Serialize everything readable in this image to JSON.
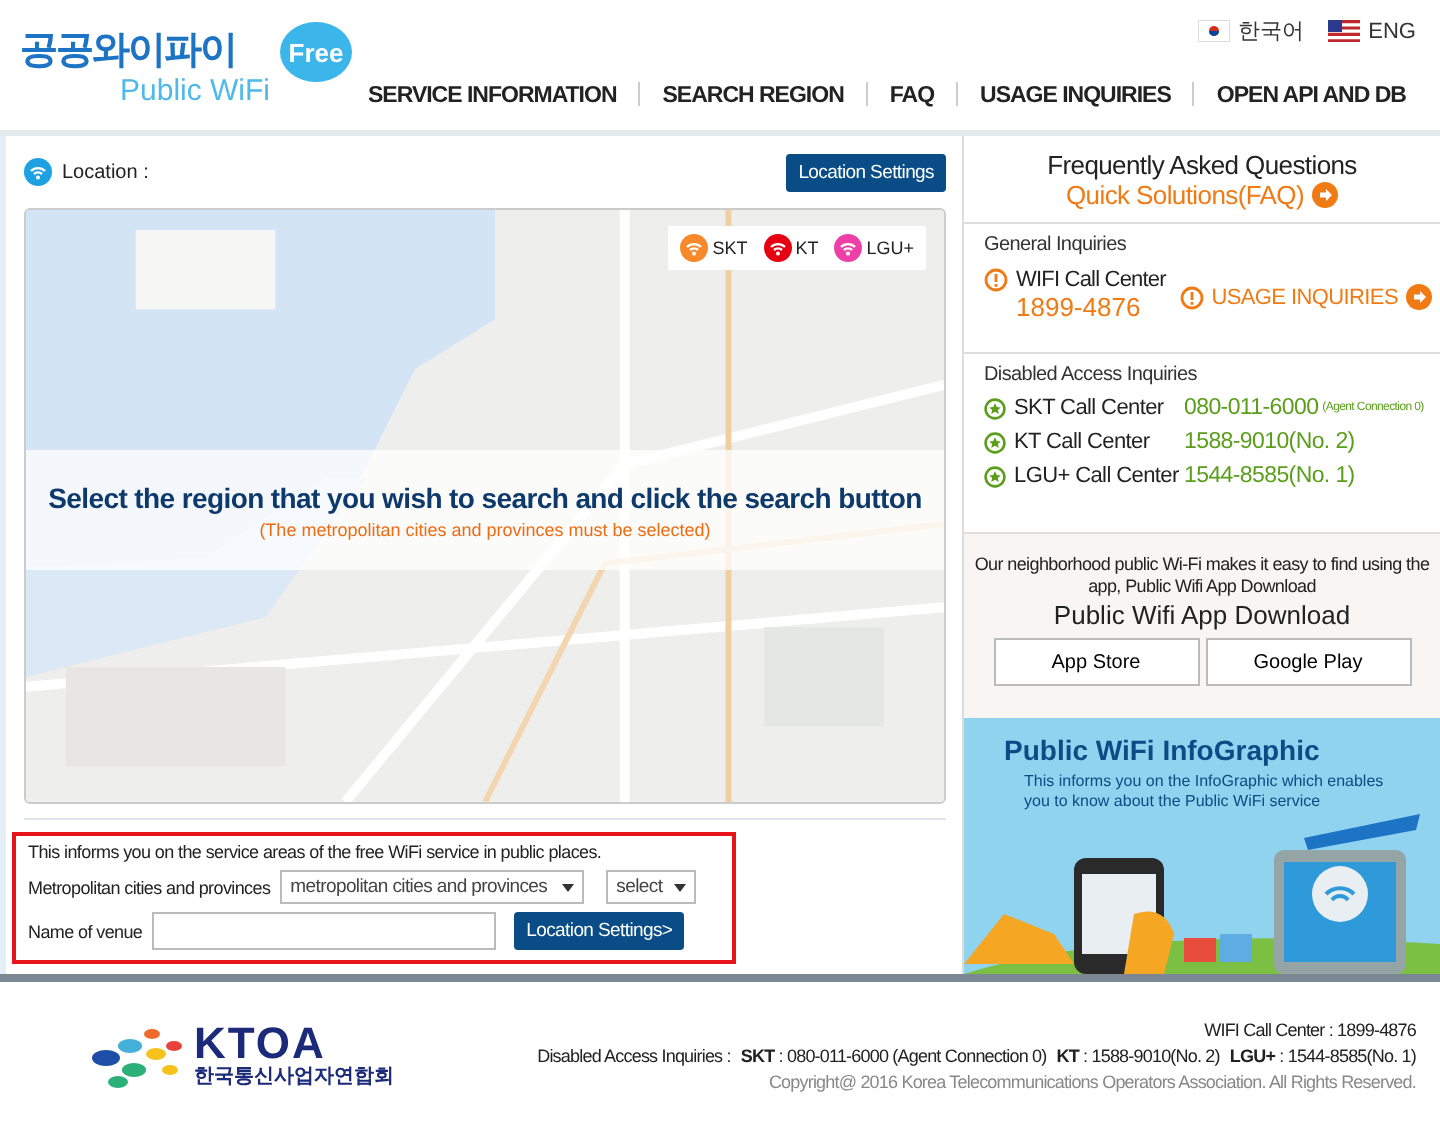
{
  "header": {
    "logo": {
      "title": "공공와이파이",
      "badge": "Free",
      "subtitle": "Public WiFi"
    },
    "languages": [
      {
        "label": "한국어"
      },
      {
        "label": "ENG"
      }
    ],
    "nav": [
      "SERVICE INFORMATION",
      "SEARCH REGION",
      "FAQ",
      "USAGE INQUIRIES",
      "OPEN API AND DB"
    ]
  },
  "map_panel": {
    "location_label": "Location :",
    "button": "Location Settings",
    "legend": [
      {
        "label": "SKT",
        "color": "#f7892b"
      },
      {
        "label": "KT",
        "color": "#e60012"
      },
      {
        "label": "LGU+",
        "color": "#ee3fa8"
      }
    ],
    "message": "Select the region that you wish to search and click the search button",
    "note": "(The metropolitan cities and provinces must be selected)"
  },
  "search": {
    "highlighted": true,
    "intro": "This informs you on the service areas of the free WiFi service in public places.",
    "region_label": "Metropolitan cities and provinces",
    "region_select": "metropolitan cities and provinces",
    "district_select": "select",
    "venue_label": "Name of venue",
    "button": "Location Settings>"
  },
  "sidebar": {
    "faq": {
      "title": "Frequently Asked Questions",
      "link": "Quick Solutions(FAQ)"
    },
    "general": {
      "heading": "General Inquiries",
      "label": "WIFI Call Center",
      "number": "1899-4876",
      "link": "USAGE INQUIRIES"
    },
    "disabled": {
      "heading": "Disabled Access Inquiries",
      "centers": [
        {
          "name": "SKT Call Center",
          "number": "080-011-6000",
          "note": "(Agent Connection 0)"
        },
        {
          "name": "KT Call Center",
          "number": "1588-9010(No. 2)"
        },
        {
          "name": "LGU+ Call Center",
          "number": "1544-8585(No. 1)"
        }
      ]
    },
    "app": {
      "text": "Our neighborhood public Wi-Fi makes it easy to find using the app, Public Wifi App Download",
      "title": "Public Wifi App Download",
      "buttons": [
        "App Store",
        "Google Play"
      ]
    },
    "infographic": {
      "title": "Public WiFi InfoGraphic",
      "subtitle": "This informs you on the InfoGraphic which enables you to know about the Public WiFi service"
    }
  },
  "footer": {
    "logo": {
      "name": "KTOA",
      "subtitle": "한국통신사업자연합회"
    },
    "call_center": "WIFI Call Center : 1899-4876",
    "disabled_label": "Disabled Access Inquiries :",
    "carriers": [
      {
        "carrier": "SKT",
        "text": ": 080-011-6000 (Agent Connection 0)"
      },
      {
        "carrier": "KT",
        "text": ": 1588-9010(No. 2)"
      },
      {
        "carrier": "LGU+",
        "text": ": 1544-8585(No. 1)"
      }
    ],
    "copyright": "Copyright@ 2016 Korea Telecommunications Operators Association. All Rights Reserved."
  }
}
